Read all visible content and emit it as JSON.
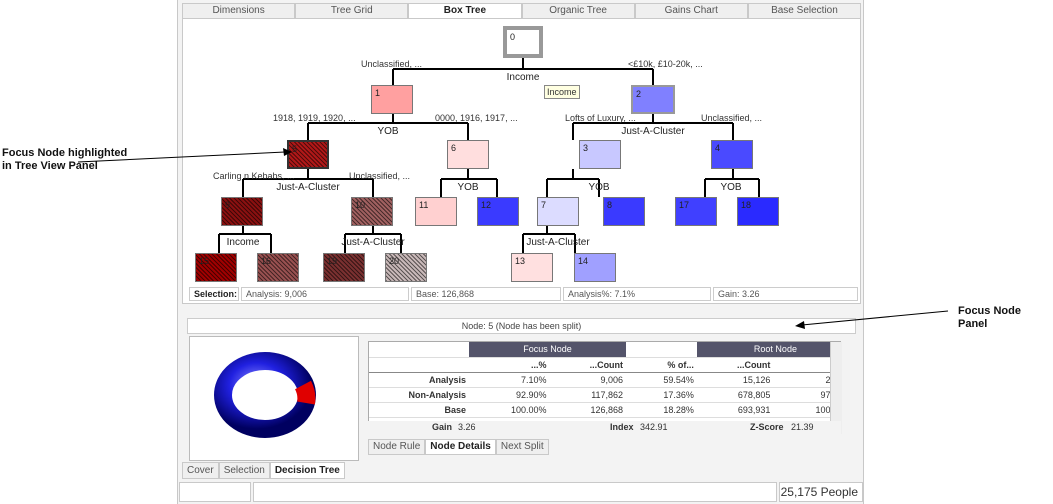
{
  "annotations": {
    "focus_tree": "Focus Node highlighted\nin Tree View Panel",
    "focus_panel": "Focus Node Panel"
  },
  "top_tabs": [
    "Dimensions",
    "Tree Grid",
    "Box Tree",
    "Organic Tree",
    "Gains Chart",
    "Base Selection"
  ],
  "active_top_tab": "Box Tree",
  "tree": {
    "node_ids": [
      "0",
      "1",
      "2",
      "3",
      "4",
      "5",
      "6",
      "7",
      "8",
      "9",
      "10",
      "11",
      "12",
      "13",
      "14",
      "15",
      "16",
      "17",
      "18",
      "19",
      "20"
    ],
    "split_vars": {
      "root": "Income",
      "n1": "YOB",
      "n2": "Just-A-Cluster",
      "n5": "Just-A-Cluster",
      "n6": "YOB",
      "n3": "YOB",
      "n4": "YOB",
      "n9": "Income",
      "n10": "Just-A-Cluster",
      "n7": "Just-A-Cluster"
    },
    "branch_labels": {
      "r_left": "Unclassified, ...",
      "r_right": "<£10k, £10-20k, ...",
      "n1_left": "1918, 1919, 1920, ...",
      "n1_right": "0000, 1916, 1917, ...",
      "n2_left": "Lofts of Luxury, ...",
      "n2_right": "Unclassified, ...",
      "n5_left": "Carling n Kebabs, ...",
      "n5_right": "Unclassified, ..."
    },
    "tooltip": "Income"
  },
  "selection_bar": {
    "label": "Selection:",
    "analysis": "Analysis: 9,006",
    "base": "Base: 126,868",
    "analysis_pct": "Analysis%: 7.1%",
    "gain": "Gain: 3.26"
  },
  "focus": {
    "title": "Node: 5 (Node has been split)",
    "group_headers": [
      "Focus Node",
      "Root Node"
    ],
    "columns": [
      "...%",
      "...Count",
      "% of...",
      "...Count",
      "...%"
    ],
    "rows": [
      {
        "label": "Analysis",
        "vals": [
          "7.10%",
          "9,006",
          "59.54%",
          "15,126",
          "2.18%"
        ]
      },
      {
        "label": "Non-Analysis",
        "vals": [
          "92.90%",
          "117,862",
          "17.36%",
          "678,805",
          "97.82%"
        ]
      },
      {
        "label": "Base",
        "vals": [
          "100.00%",
          "126,868",
          "18.28%",
          "693,931",
          "100.00%"
        ]
      }
    ],
    "gain_label": "Gain",
    "gain": "3.26",
    "index_label": "Index",
    "index": "342.91",
    "z_label": "Z-Score",
    "z": "21.39",
    "subtabs": [
      "Node Rule",
      "Node Details",
      "Next Split"
    ],
    "active_subtab": "Node Details"
  },
  "bottom_tabs": [
    "Cover",
    "Selection",
    "Decision Tree"
  ],
  "active_bottom_tab": "Decision Tree",
  "status": {
    "people": "25,175 People"
  },
  "colors": {
    "red": "#ff9a9a",
    "blue": "#8080ff",
    "dark_red": "#9a1010",
    "deep_blue": "#3030ff",
    "header": "#54546a"
  }
}
